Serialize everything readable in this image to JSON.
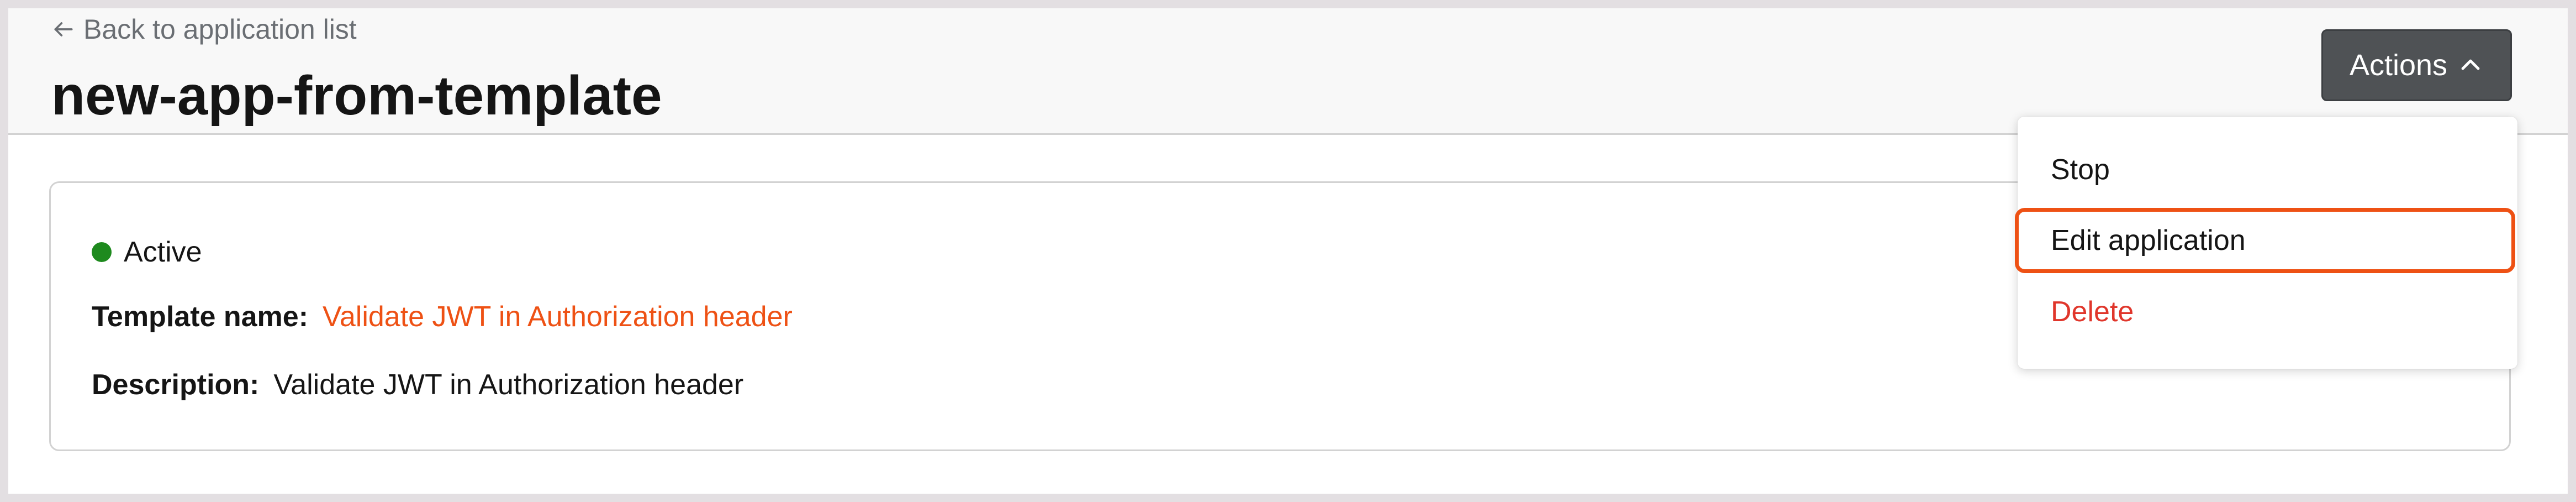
{
  "header": {
    "back_link_label": "Back to application list",
    "title": "new-app-from-template",
    "actions_button_label": "Actions"
  },
  "details": {
    "status": "Active",
    "template_name_label": "Template name:",
    "template_name_value": "Validate JWT in Authorization header",
    "description_label": "Description:",
    "description_value": "Validate JWT in Authorization header"
  },
  "actions_menu": {
    "items": [
      "Stop",
      "Edit application",
      "Delete"
    ],
    "highlighted": "Edit application"
  },
  "colors": {
    "accent_orange": "#ee5114",
    "status_active": "#1e8a1e",
    "danger": "#e0362b",
    "button_dark": "#4f5255"
  },
  "icons": {
    "back": "arrow-left-icon",
    "actions_toggle": "chevron-up-icon",
    "status": "status-dot-icon"
  }
}
